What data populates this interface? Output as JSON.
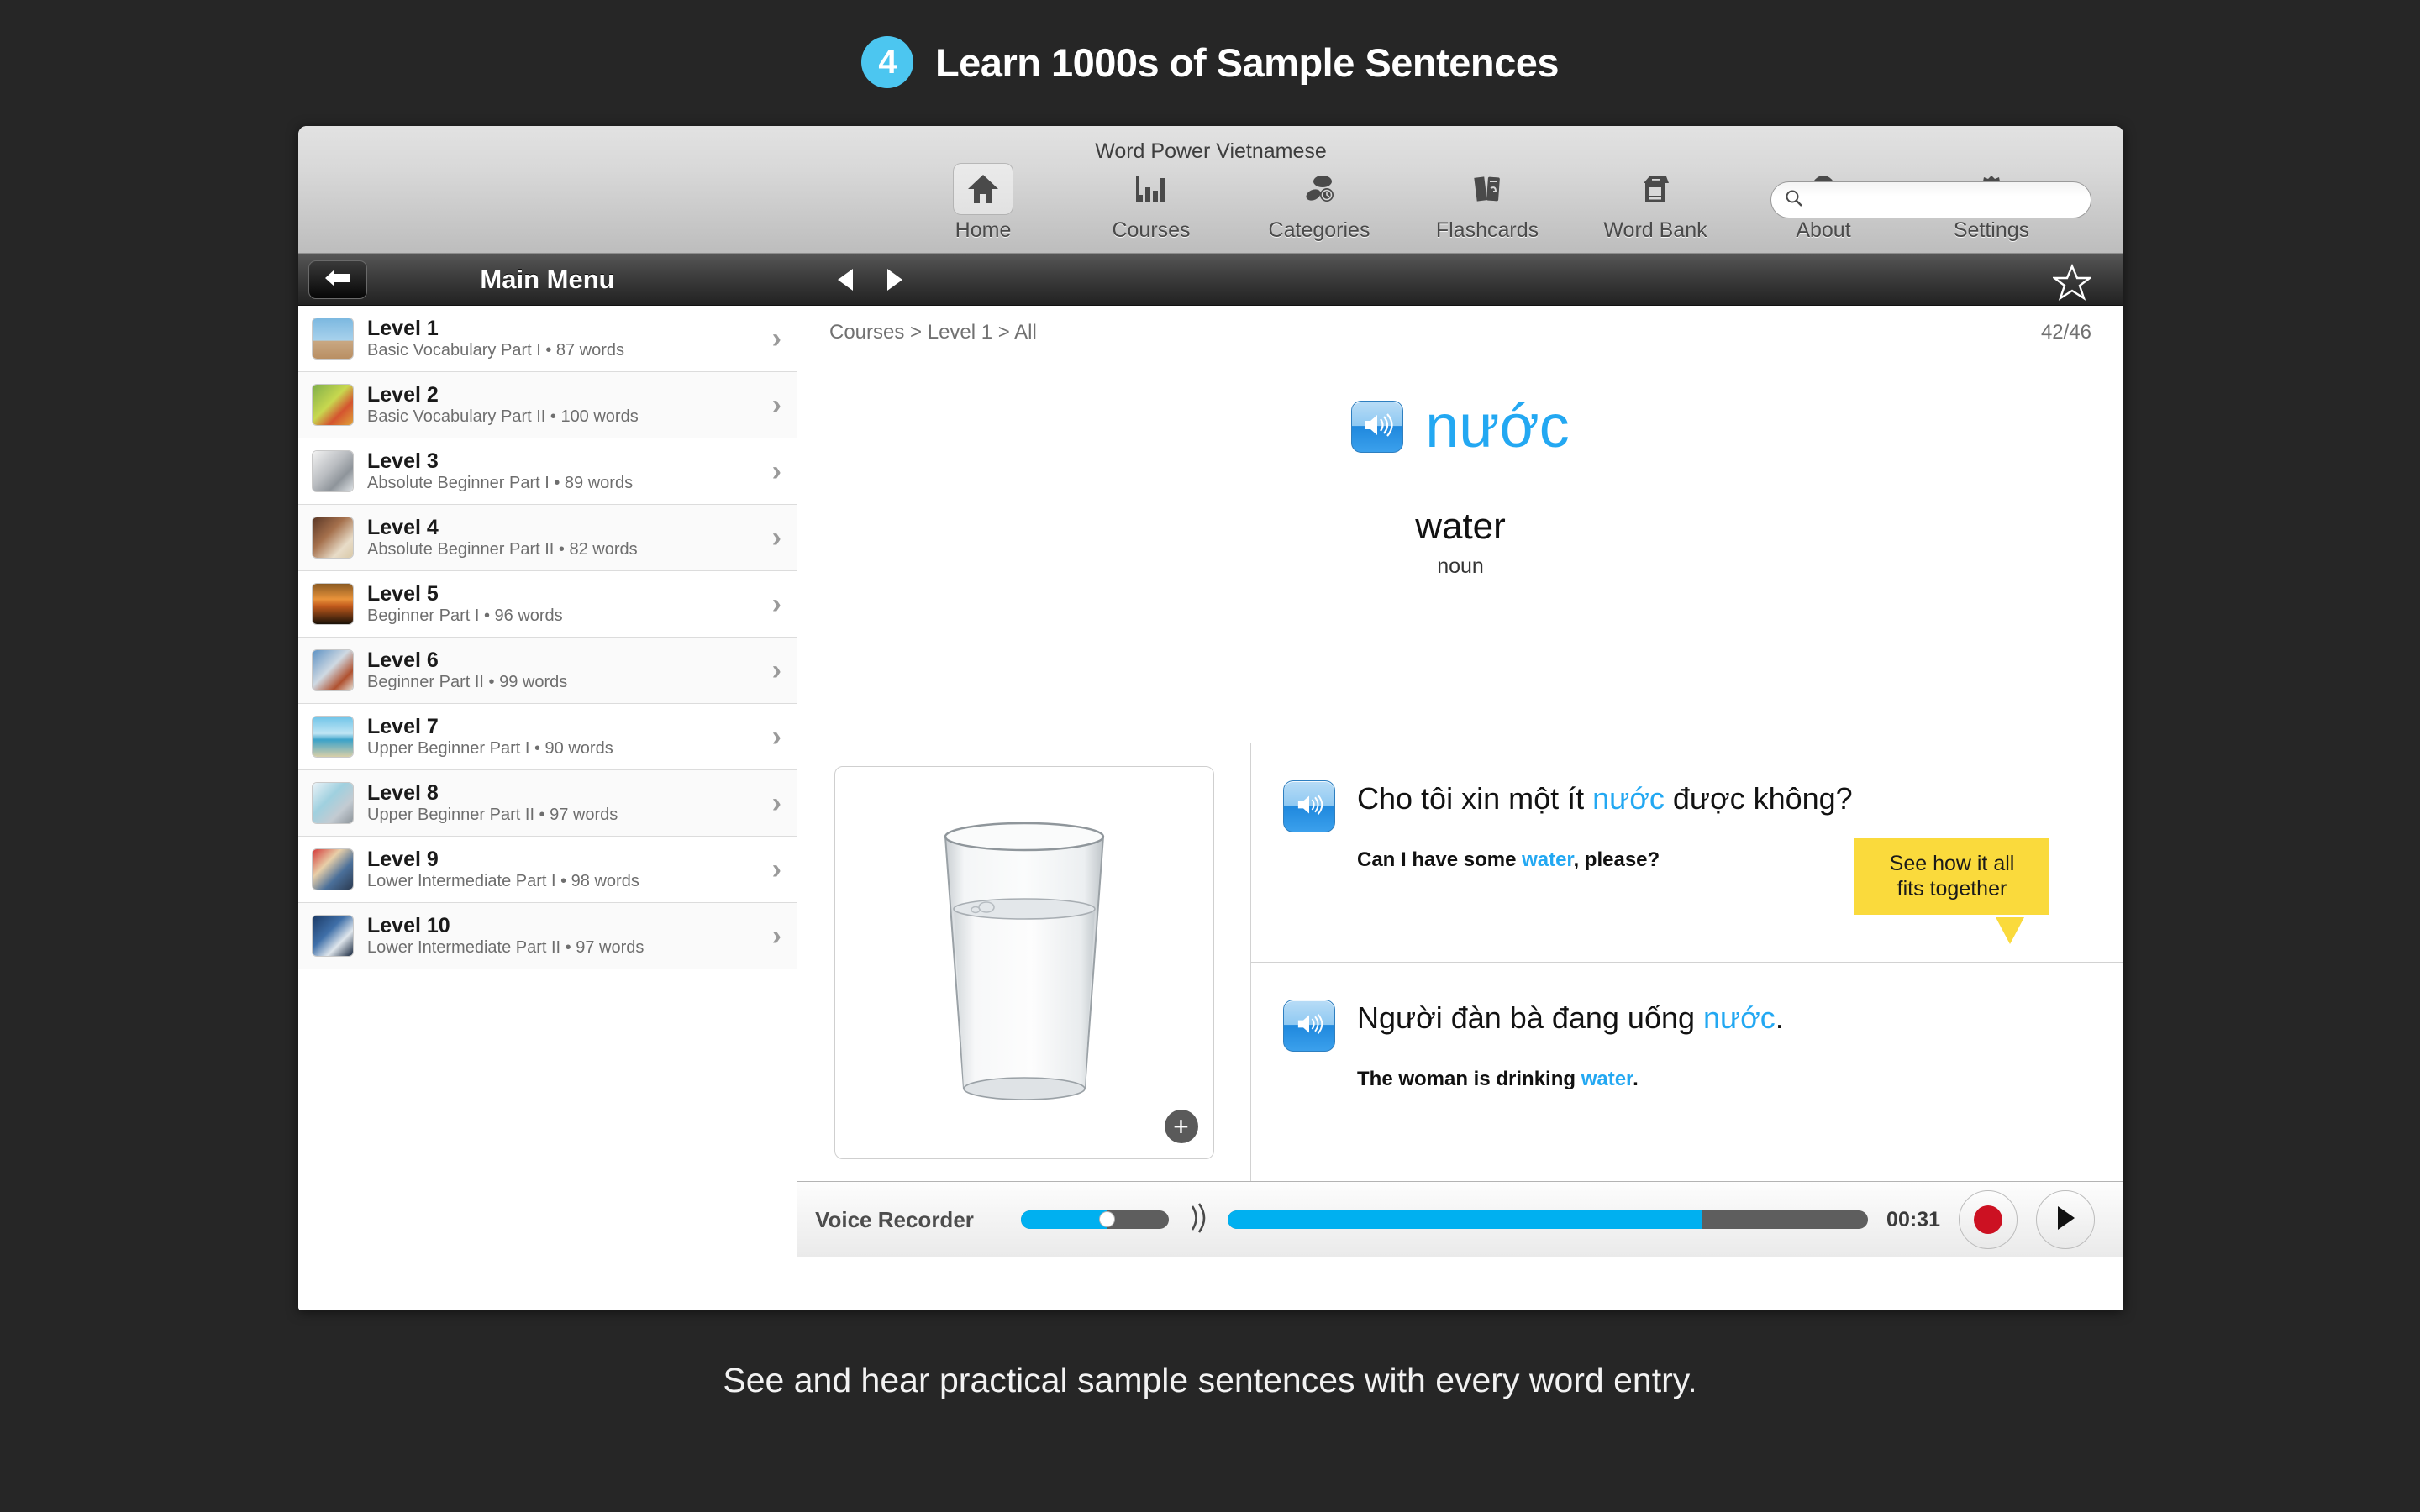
{
  "promo": {
    "step": "4",
    "title": "Learn 1000s of Sample Sentences",
    "caption": "See and hear practical sample sentences with every word entry.",
    "badge_color": "#4cc6f0"
  },
  "window": {
    "title": "Word Power Vietnamese"
  },
  "toolbar": {
    "items": [
      {
        "label": "Home",
        "icon": "home-icon",
        "selected": true
      },
      {
        "label": "Courses",
        "icon": "bar-chart-icon",
        "selected": false
      },
      {
        "label": "Categories",
        "icon": "categories-icon",
        "selected": false
      },
      {
        "label": "Flashcards",
        "icon": "flashcards-icon",
        "selected": false
      },
      {
        "label": "Word Bank",
        "icon": "word-bank-icon",
        "selected": false
      },
      {
        "label": "About",
        "icon": "question-circle-icon",
        "selected": false
      },
      {
        "label": "Settings",
        "icon": "gear-icon",
        "selected": false
      }
    ],
    "search": {
      "value": "",
      "placeholder": ""
    }
  },
  "sidebar": {
    "title": "Main Menu",
    "back_icon": "back-arrow-icon",
    "items": [
      {
        "title": "Level 1",
        "subtitle": "Basic Vocabulary Part I • 87 words"
      },
      {
        "title": "Level 2",
        "subtitle": "Basic Vocabulary Part II • 100 words"
      },
      {
        "title": "Level 3",
        "subtitle": "Absolute Beginner Part I • 89 words"
      },
      {
        "title": "Level 4",
        "subtitle": "Absolute Beginner Part II • 82 words"
      },
      {
        "title": "Level 5",
        "subtitle": "Beginner Part I • 96 words"
      },
      {
        "title": "Level 6",
        "subtitle": "Beginner Part II • 99 words"
      },
      {
        "title": "Level 7",
        "subtitle": "Upper Beginner Part I • 90 words"
      },
      {
        "title": "Level 8",
        "subtitle": "Upper Beginner Part II • 97 words"
      },
      {
        "title": "Level 9",
        "subtitle": "Lower Intermediate Part I • 98 words"
      },
      {
        "title": "Level 10",
        "subtitle": "Lower Intermediate Part II • 97 words"
      }
    ]
  },
  "main": {
    "breadcrumb": "Courses > Level 1 > All",
    "counter": "42/46",
    "word": "nước",
    "translation": "water",
    "part_of_speech": "noun",
    "accent_color": "#23a8f2",
    "tooltip": {
      "line1": "See how it all",
      "line2": "fits together",
      "color": "#fada3c"
    },
    "image_zoom_badge": "+",
    "sentences": [
      {
        "target_pre": "Cho tôi xin một ít ",
        "target_highlight": "nước",
        "target_post": " được không?",
        "translation_pre": "Can I have some ",
        "translation_highlight": "water",
        "translation_post": ", please?"
      },
      {
        "target_pre": "Người đàn bà đang uống ",
        "target_highlight": "nước",
        "target_post": ".",
        "translation_pre": "The woman is drinking ",
        "translation_highlight": "water",
        "translation_post": "."
      }
    ]
  },
  "recorder": {
    "label": "Voice Recorder",
    "time": "00:31",
    "volume_percent": 58,
    "progress_percent": 74,
    "record_color": "#cc1122"
  }
}
